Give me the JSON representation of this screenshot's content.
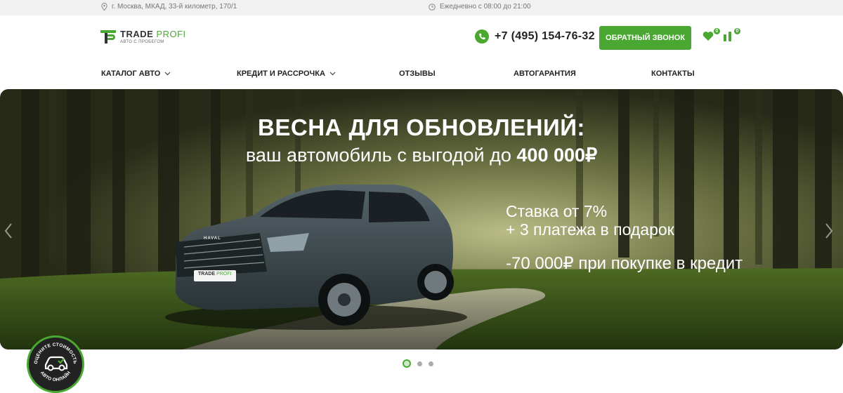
{
  "topbar": {
    "address": "г. Москва, МКАД, 33-й километр, 170/1",
    "hours": "Ежедневно с 08:00 до 21:00"
  },
  "logo": {
    "name_main": "TRADE",
    "name_accent": "PROFI",
    "tagline": "АВТО С ПРОБЕГОМ"
  },
  "header": {
    "phone": "+7 (495) 154-76-32",
    "callback_label": "ОБРАТНЫЙ ЗВОНОК",
    "favorites_count": "0",
    "compare_count": "0"
  },
  "nav": {
    "items": [
      {
        "label": "КАТАЛОГ АВТО",
        "has_dropdown": true
      },
      {
        "label": "КРЕДИТ И РАССРОЧКА",
        "has_dropdown": true
      },
      {
        "label": "ОТЗЫВЫ",
        "has_dropdown": false
      },
      {
        "label": "АВТОГАРАНТИЯ",
        "has_dropdown": false
      },
      {
        "label": "КОНТАКТЫ",
        "has_dropdown": false
      }
    ]
  },
  "banner": {
    "title": "ВЕСНА ДЛЯ ОБНОВЛЕНИЙ:",
    "subtitle_prefix": "ваш автомобиль с выгодой до",
    "subtitle_amount": "400 000₽",
    "offer_line1": "Ставка от 7%",
    "offer_line2": "+ 3 платежа в подарок",
    "offer_line3": "-70 000₽ при покупке в кредит",
    "car_grille_text": "HAVAL",
    "plate_text_main": "TRADE",
    "plate_text_accent": "PROFI"
  },
  "slider": {
    "slide_count": 3,
    "active_index": 0
  },
  "eval_widget": {
    "top_text": "ОЦЕНИТЕ СТОИМОСТЬ",
    "bottom_text": "АВТО ОНЛАЙН"
  },
  "colors": {
    "accent": "#4aa832",
    "topbar_bg": "#f1f1f1"
  },
  "icons": [
    "location-icon",
    "clock-icon",
    "phone-icon",
    "heart-icon",
    "compare-icon",
    "chevron-down-icon",
    "arrow-left-icon",
    "arrow-right-icon",
    "car-icon"
  ]
}
